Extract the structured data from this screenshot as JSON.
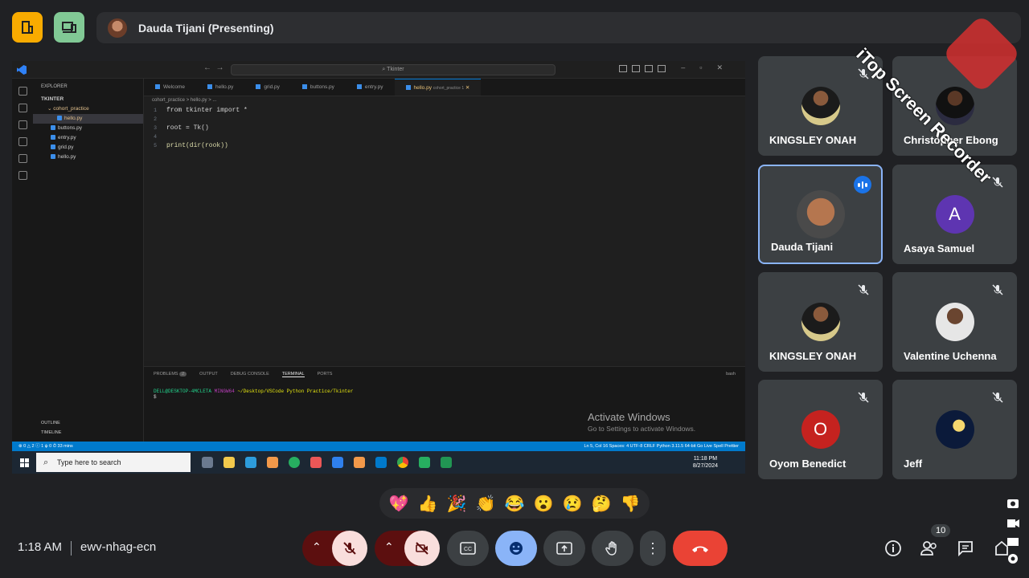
{
  "meeting": {
    "presenter_banner": "Dauda Tijani (Presenting)",
    "time": "1:18 AM",
    "code": "ewv-nhag-ecn",
    "participant_count": "10"
  },
  "vscode": {
    "search": "Tkinter",
    "explorer_header": "EXPLORER",
    "root_folder": "TKINTER",
    "subfolder": "cohort_practice",
    "sub_file": "hello.py",
    "files": [
      "buttons.py",
      "entry.py",
      "grid.py",
      "hello.py"
    ],
    "tabs": [
      "Welcome",
      "hello.py",
      "grid.py",
      "buttons.py",
      "entry.py",
      "hello.py"
    ],
    "active_tab_suffix": "cohort_practice 1",
    "breadcrumb": "cohort_practice > hello.py > ...",
    "code_lines": [
      {
        "n": "1",
        "text": "from tkinter import *"
      },
      {
        "n": "2",
        "text": ""
      },
      {
        "n": "3",
        "text": "root = Tk()"
      },
      {
        "n": "4",
        "text": ""
      },
      {
        "n": "5",
        "text": "print(dir(rook))"
      }
    ],
    "panel_tabs": [
      "PROBLEMS",
      "OUTPUT",
      "DEBUG CONSOLE",
      "TERMINAL",
      "PORTS"
    ],
    "problems_count": "2",
    "terminal_shell": "bash",
    "terminal_user": "DELL@DESKTOP-4MCLETA",
    "terminal_env": "MINGW64",
    "terminal_path": "~/Desktop/VSCode Python Practice/Tkinter",
    "terminal_prompt": "$",
    "outline": "OUTLINE",
    "timeline": "TIMELINE",
    "status_left": "⊗ 0 △ 2 ⓘ 1   ψ 0   ⏱ 33 mins",
    "status_right": "Ln 5, Col 16   Spaces: 4   UTF-8   CRLF   Python   3.11.5 64-bit   Go Live   Spell   Prettier"
  },
  "windows": {
    "activate_title": "Activate Windows",
    "activate_sub": "Go to Settings to activate Windows.",
    "search_placeholder": "Type here to search",
    "clock_time": "11:18 PM",
    "clock_date": "8/27/2024"
  },
  "participants": [
    {
      "name": "KINGSLEY ONAH",
      "muted": true
    },
    {
      "name": "Christopher Ebong",
      "muted": true
    },
    {
      "name": "Dauda Tijani",
      "muted": false,
      "speaking": true
    },
    {
      "name": "Asaya Samuel",
      "muted": true,
      "initial": "A",
      "color": "#5e35b1"
    },
    {
      "name": "KINGSLEY ONAH",
      "muted": true
    },
    {
      "name": "Valentine Uchenna",
      "muted": true
    },
    {
      "name": "Oyom Benedict",
      "muted": true,
      "initial": "O",
      "color": "#c5221f"
    },
    {
      "name": "Jeff",
      "muted": true
    }
  ],
  "reactions": [
    "💖",
    "👍",
    "🎉",
    "👏",
    "😂",
    "😮",
    "😢",
    "🤔",
    "👎"
  ],
  "watermark": "iTop Screen Recorder",
  "colors": {
    "accent": "#8ab4f8",
    "end_call": "#ea4335",
    "mic_off_bg": "#f9dedc",
    "dark_red": "#5c0f0f"
  }
}
